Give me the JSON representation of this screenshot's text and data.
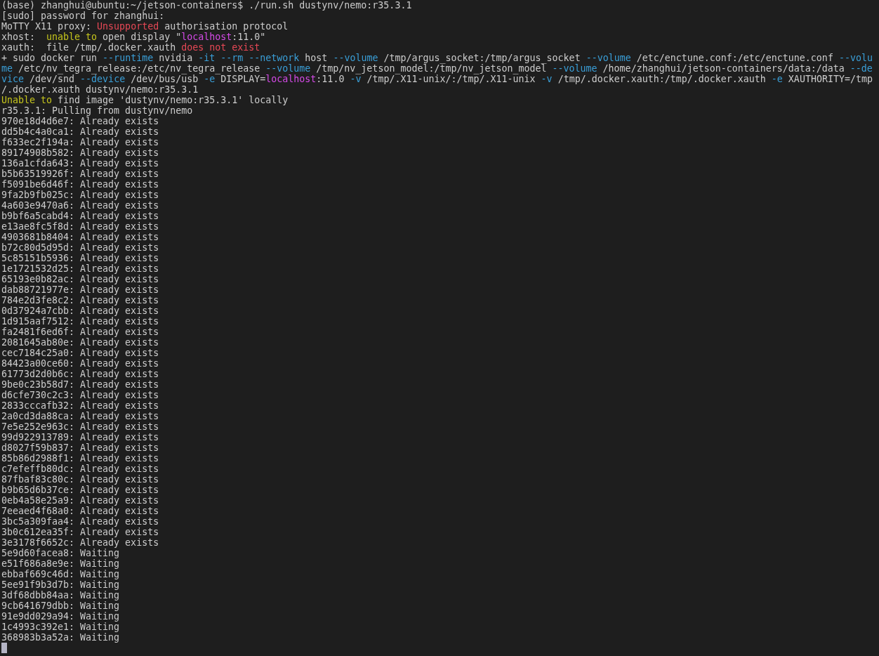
{
  "terminal": {
    "lines": [
      [
        {
          "text": "(base) zhanghui@ubuntu:~/jetson-containers$ ./run.sh dustynv/nemo:r35.3.1"
        }
      ],
      [
        {
          "text": "[sudo] password for zhanghui:"
        }
      ],
      [
        {
          "text": "MoTTY X11 proxy: "
        },
        {
          "text": "Unsupported",
          "color": "#e74856"
        },
        {
          "text": " authorisation protocol"
        }
      ],
      [
        {
          "text": "xhost:  "
        },
        {
          "text": "unable to",
          "color": "#c5c51c"
        },
        {
          "text": " open display \""
        },
        {
          "text": "localhost",
          "color": "#d54ae8"
        },
        {
          "text": ":11.0\""
        }
      ],
      [
        {
          "text": "xauth:  file /tmp/.docker.xauth "
        },
        {
          "text": "does not exist",
          "color": "#e74856"
        }
      ],
      [
        {
          "text": "+ sudo docker run "
        },
        {
          "text": "--runtime",
          "color": "#3a9fd8"
        },
        {
          "text": " nvidia "
        },
        {
          "text": "-it ",
          "color": "#3a9fd8"
        },
        {
          "text": "--rm ",
          "color": "#3a9fd8"
        },
        {
          "text": "--network",
          "color": "#3a9fd8"
        },
        {
          "text": " host "
        },
        {
          "text": "--volume",
          "color": "#3a9fd8"
        },
        {
          "text": " /tmp/argus_socket:/tmp/argus_socket "
        },
        {
          "text": "--volume",
          "color": "#3a9fd8"
        },
        {
          "text": " /etc/enctune.conf:/etc/enctune.conf "
        },
        {
          "text": "--volu",
          "color": "#3a9fd8"
        }
      ],
      [
        {
          "text": "me",
          "color": "#3a9fd8"
        },
        {
          "text": " /etc/nv_tegra_release:/etc/nv_tegra_release "
        },
        {
          "text": "--volume",
          "color": "#3a9fd8"
        },
        {
          "text": " /tmp/nv_jetson_model:/tmp/nv_jetson_model "
        },
        {
          "text": "--volume",
          "color": "#3a9fd8"
        },
        {
          "text": " /home/zhanghui/jetson-containers/data:/data "
        },
        {
          "text": "--de",
          "color": "#3a9fd8"
        }
      ],
      [
        {
          "text": "vice",
          "color": "#3a9fd8"
        },
        {
          "text": " /dev/snd "
        },
        {
          "text": "--device",
          "color": "#3a9fd8"
        },
        {
          "text": " /dev/bus/usb "
        },
        {
          "text": "-e",
          "color": "#3a9fd8"
        },
        {
          "text": " DISPLAY="
        },
        {
          "text": "localhost",
          "color": "#d54ae8"
        },
        {
          "text": ":11.0 "
        },
        {
          "text": "-v",
          "color": "#3a9fd8"
        },
        {
          "text": " /tmp/.X11-unix/:/tmp/.X11-unix "
        },
        {
          "text": "-v",
          "color": "#3a9fd8"
        },
        {
          "text": " /tmp/.docker.xauth:/tmp/.docker.xauth "
        },
        {
          "text": "-e",
          "color": "#3a9fd8"
        },
        {
          "text": " XAUTHORITY=/tmp"
        }
      ],
      [
        {
          "text": "/.docker.xauth dustynv/nemo:r35.3.1"
        }
      ],
      [
        {
          "text": "Unable to",
          "color": "#c5c51c"
        },
        {
          "text": " find image 'dustynv/nemo:r35.3.1' locally"
        }
      ],
      [
        {
          "text": "r35.3.1: Pulling from dustynv/nemo"
        }
      ],
      [
        {
          "text": "970e18d4d6e7: Already exists"
        }
      ],
      [
        {
          "text": "dd5b4c4a0ca1: Already exists"
        }
      ],
      [
        {
          "text": "f633ec2f194a: Already exists"
        }
      ],
      [
        {
          "text": "89174908b582: Already exists"
        }
      ],
      [
        {
          "text": "136a1cfda643: Already exists"
        }
      ],
      [
        {
          "text": "b5b63519926f: Already exists"
        }
      ],
      [
        {
          "text": "f5091be6d46f: Already exists"
        }
      ],
      [
        {
          "text": "9fa2b9fb025c: Already exists"
        }
      ],
      [
        {
          "text": "4a603e9470a6: Already exists"
        }
      ],
      [
        {
          "text": "b9bf6a5cabd4: Already exists"
        }
      ],
      [
        {
          "text": "e13ae8fc5f8d: Already exists"
        }
      ],
      [
        {
          "text": "4903681b8404: Already exists"
        }
      ],
      [
        {
          "text": "b72c80d5d95d: Already exists"
        }
      ],
      [
        {
          "text": "5c85151b5936: Already exists"
        }
      ],
      [
        {
          "text": "1e1721532d25: Already exists"
        }
      ],
      [
        {
          "text": "65193e0b82ac: Already exists"
        }
      ],
      [
        {
          "text": "dab88721977e: Already exists"
        }
      ],
      [
        {
          "text": "784e2d3fe8c2: Already exists"
        }
      ],
      [
        {
          "text": "0d37924a7cbb: Already exists"
        }
      ],
      [
        {
          "text": "1d915aaf7512: Already exists"
        }
      ],
      [
        {
          "text": "fa2481f6ed6f: Already exists"
        }
      ],
      [
        {
          "text": "2081645ab80e: Already exists"
        }
      ],
      [
        {
          "text": "cec7184c25a0: Already exists"
        }
      ],
      [
        {
          "text": "84423a00ce60: Already exists"
        }
      ],
      [
        {
          "text": "61773d2d0b6c: Already exists"
        }
      ],
      [
        {
          "text": "9be0c23b58d7: Already exists"
        }
      ],
      [
        {
          "text": "d6cfe730c2c3: Already exists"
        }
      ],
      [
        {
          "text": "2833cccafb32: Already exists"
        }
      ],
      [
        {
          "text": "2a0cd3da88ca: Already exists"
        }
      ],
      [
        {
          "text": "7e5e252e963c: Already exists"
        }
      ],
      [
        {
          "text": "99d922913789: Already exists"
        }
      ],
      [
        {
          "text": "d8027f59b837: Already exists"
        }
      ],
      [
        {
          "text": "85b86d2988f1: Already exists"
        }
      ],
      [
        {
          "text": "c7efeffb80dc: Already exists"
        }
      ],
      [
        {
          "text": "87fbaf83c80c: Already exists"
        }
      ],
      [
        {
          "text": "b9b65d6b37ce: Already exists"
        }
      ],
      [
        {
          "text": "0eb4a58e25a9: Already exists"
        }
      ],
      [
        {
          "text": "7eeaed4f68a0: Already exists"
        }
      ],
      [
        {
          "text": "3bc5a309faa4: Already exists"
        }
      ],
      [
        {
          "text": "3b0c612ea35f: Already exists"
        }
      ],
      [
        {
          "text": "3e3178f6652c: Already exists"
        }
      ],
      [
        {
          "text": "5e9d60facea8: Waiting"
        }
      ],
      [
        {
          "text": "e51f686a8e9e: Waiting"
        }
      ],
      [
        {
          "text": "ebbaf669c46d: Waiting"
        }
      ],
      [
        {
          "text": "5ee91f9b3d7b: Waiting"
        }
      ],
      [
        {
          "text": "3df68dbb84aa: Waiting"
        }
      ],
      [
        {
          "text": "9cb641679dbb: Waiting"
        }
      ],
      [
        {
          "text": "91e9dd029a94: Waiting"
        }
      ],
      [
        {
          "text": "1c4993c392e1: Waiting"
        }
      ],
      [
        {
          "text": "368983b3a52a: Waiting"
        }
      ]
    ]
  }
}
